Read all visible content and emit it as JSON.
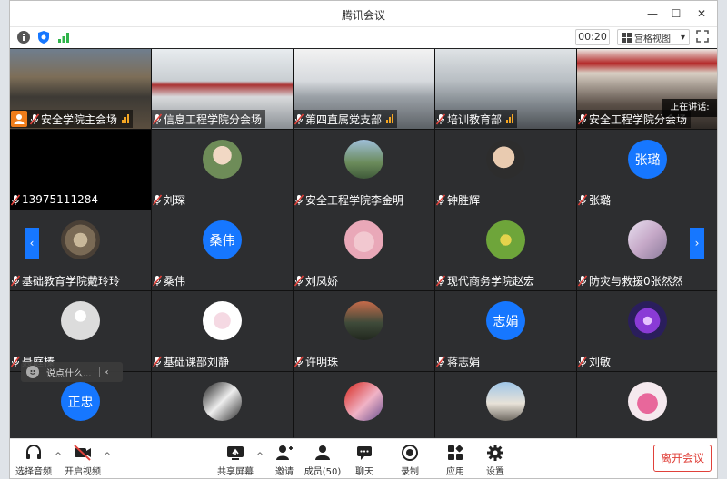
{
  "window": {
    "title": "腾讯会议",
    "minimize_glyph": "—",
    "maximize_glyph": "☐",
    "close_glyph": "✕"
  },
  "infobar": {
    "timer": "00:20",
    "view_label": "宫格视图",
    "view_caret": "▾"
  },
  "speaking_label": "正在讲话:",
  "page_prev_glyph": "‹",
  "page_next_glyph": "›",
  "participants": [
    {
      "name": "安全学院主会场",
      "host": true,
      "signal": 3
    },
    {
      "name": "信息工程学院分会场"
    },
    {
      "name": "第四直属党支部",
      "signal": 3
    },
    {
      "name": "培训教育部",
      "signal": 3
    },
    {
      "name": "安全工程学院分会场"
    },
    {
      "name": "13975111284"
    },
    {
      "name": "刘琛"
    },
    {
      "name": "安全工程学院李金明"
    },
    {
      "name": "钟胜辉"
    },
    {
      "name": "张璐",
      "avatar_text": "张璐"
    },
    {
      "name": "基础教育学院戴玲玲"
    },
    {
      "name": "桑伟",
      "avatar_text": "桑伟"
    },
    {
      "name": "刘凤娇"
    },
    {
      "name": "现代商务学院赵宏"
    },
    {
      "name": "防灾与救援0张然然"
    },
    {
      "name": "聂庭榛"
    },
    {
      "name": "基础课部刘静"
    },
    {
      "name": "许明珠"
    },
    {
      "name": "蒋志娟",
      "avatar_text": "志娟"
    },
    {
      "name": "刘敏"
    },
    {
      "name": "",
      "avatar_text": "正忠"
    }
  ],
  "chat": {
    "placeholder": "说点什么...",
    "collapse_glyph": "‹"
  },
  "toolbar": {
    "audio": "选择音频",
    "video": "开启视频",
    "share": "共享屏幕",
    "invite": "邀请",
    "members": "成员(50)",
    "chat": "聊天",
    "record": "录制",
    "apps": "应用",
    "settings": "设置",
    "leave": "离开会议",
    "caret": "^"
  },
  "colors": {
    "accent": "#1677ff",
    "host_badge": "#f07d1a",
    "signal": "#f5a623",
    "leave": "#e0413a",
    "tile_bg": "#2d2e30",
    "toolbar_bg": "#ffffff"
  }
}
